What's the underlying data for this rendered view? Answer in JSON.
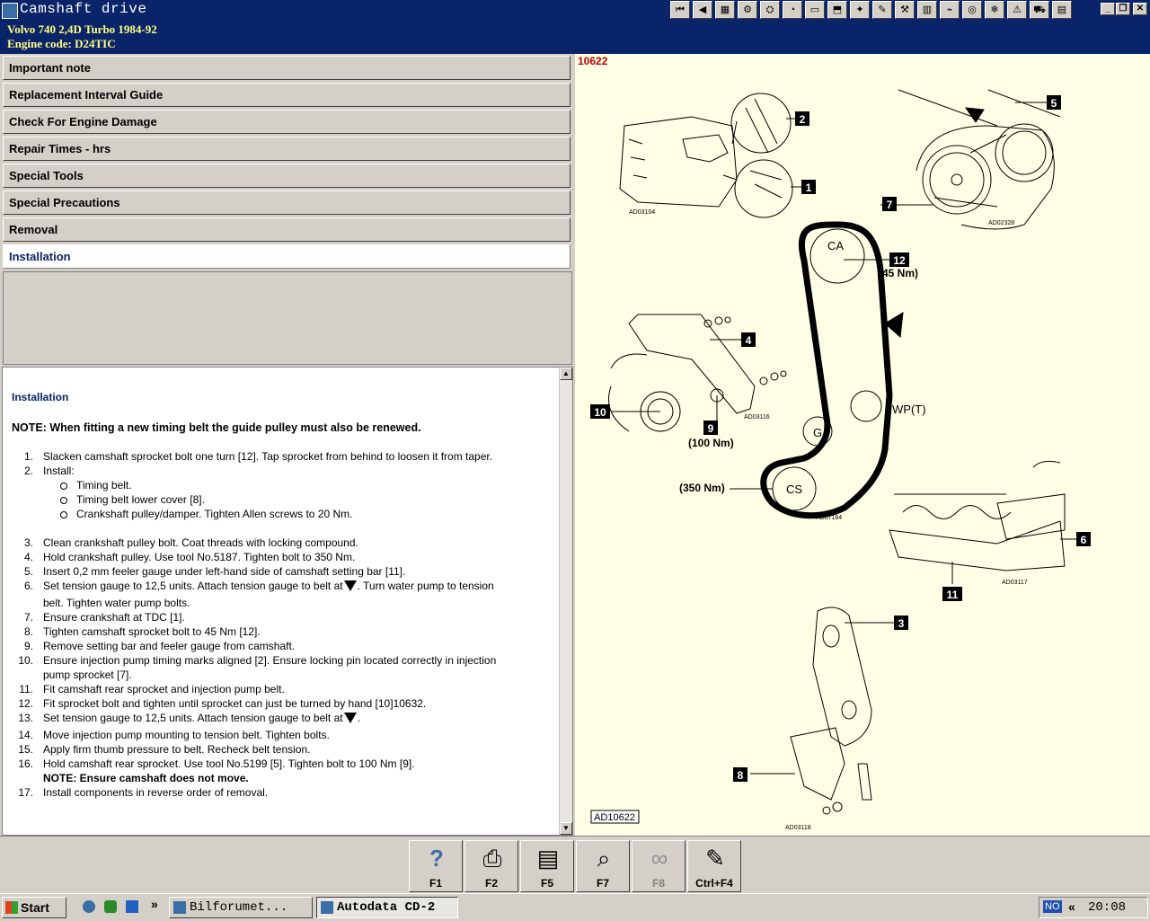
{
  "window": {
    "title": "Camshaft drive",
    "toolbar_icons": [
      "first-page-icon",
      "prev-page-icon",
      "image-icon",
      "tools-icon",
      "engine-icon",
      "gauge-icon",
      "battery-icon",
      "car-lift-icon",
      "spark-plug-icon",
      "wrench-icon",
      "repair-icon",
      "manual-icon",
      "wiring-icon",
      "brake-icon",
      "ac-icon",
      "warning-icon",
      "service-icon",
      "notes-icon"
    ],
    "controls": {
      "minimize": "_",
      "restore": "❐",
      "close": "✕"
    }
  },
  "vehicle": {
    "model": "Volvo   740 2,4D Turbo 1984-92",
    "engine_code": "Engine code: D24TIC"
  },
  "menu": {
    "items": [
      {
        "label": "Important note"
      },
      {
        "label": "Replacement Interval Guide"
      },
      {
        "label": "Check For Engine Damage"
      },
      {
        "label": "Repair Times - hrs"
      },
      {
        "label": "Special Tools"
      },
      {
        "label": "Special Precautions"
      },
      {
        "label": "Removal"
      },
      {
        "label": "Installation",
        "active": true
      }
    ]
  },
  "content": {
    "heading": "Installation",
    "note": "NOTE: When fitting a new timing belt the guide pulley must also be renewed.",
    "steps": [
      {
        "n": "1.",
        "lines": [
          "Slacken camshaft sprocket bolt one turn [12]. Tap sprocket from behind to loosen it from taper."
        ]
      },
      {
        "n": "2.",
        "lines": [
          "Install:"
        ],
        "sub": [
          "Timing belt.",
          "Timing belt lower cover [8].",
          "Crankshaft pulley/damper. Tighten Allen screws to 20 Nm."
        ]
      },
      {
        "n": "3.",
        "lines": [
          "Clean crankshaft pulley bolt. Coat threads with locking compound."
        ]
      },
      {
        "n": "4.",
        "lines": [
          "Hold crankshaft pulley. Use tool No.5187. Tighten bolt to 350 Nm."
        ]
      },
      {
        "n": "5.",
        "lines": [
          "Insert 0,2 mm feeler gauge under left-hand side of camshaft setting bar [11]."
        ]
      },
      {
        "n": "6.",
        "lines": [
          "Set tension gauge to 12,5 units. Attach tension gauge to belt at",
          ". Turn water pump to tension",
          "belt. Tighten water pump bolts."
        ]
      },
      {
        "n": "7.",
        "lines": [
          "Ensure crankshaft at TDC [1]."
        ]
      },
      {
        "n": "8.",
        "lines": [
          "Tighten camshaft sprocket bolt to 45 Nm [12]."
        ]
      },
      {
        "n": "9.",
        "lines": [
          "Remove setting bar and feeler gauge from camshaft."
        ]
      },
      {
        "n": "10.",
        "lines": [
          "Ensure injection pump timing marks aligned [2]. Ensure locking pin located correctly in injection",
          "pump sprocket [7]."
        ]
      },
      {
        "n": "11.",
        "lines": [
          "Fit camshaft rear sprocket and injection pump belt."
        ]
      },
      {
        "n": "12.",
        "lines": [
          "Fit sprocket bolt and tighten until sprocket can just be turned by hand [10]10632."
        ]
      },
      {
        "n": "13.",
        "lines": [
          "Set tension gauge to 12,5 units. Attach tension gauge to belt at",
          "."
        ]
      },
      {
        "n": "14.",
        "lines": [
          "Move injection pump mounting to tension belt. Tighten bolts."
        ]
      },
      {
        "n": "15.",
        "lines": [
          "Apply firm thumb pressure to belt. Recheck belt tension."
        ]
      },
      {
        "n": "16.",
        "lines": [
          "Hold camshaft rear sprocket. Use tool No.5199 [5]. Tighten bolt to 100 Nm [9].",
          "NOTE: Ensure camshaft does not move."
        ]
      },
      {
        "n": "17.",
        "lines": [
          "Install components in reverse order of removal."
        ]
      }
    ]
  },
  "diagram": {
    "ref": "10622",
    "code": "AD10622",
    "callouts": [
      "1",
      "2",
      "3",
      "4",
      "5",
      "6",
      "7",
      "8",
      "9",
      "10",
      "11",
      "12"
    ],
    "labels": {
      "ca": "CA",
      "wp": "WP(T)",
      "g": "G",
      "cs": "CS",
      "t12": "(45 Nm)",
      "t9": "(100 Nm)",
      "tcs": "(350 Nm)"
    },
    "subcodes": [
      "AD03104",
      "AD02328",
      "AD03116",
      "AD07184",
      "AD03117",
      "AD03118"
    ]
  },
  "function_keys": [
    {
      "label": "F1",
      "icon": "help-icon"
    },
    {
      "label": "F2",
      "icon": "print-icon"
    },
    {
      "label": "F5",
      "icon": "book-icon"
    },
    {
      "label": "F7",
      "icon": "zoom-icon"
    },
    {
      "label": "F8",
      "icon": "belt-icon",
      "disabled": true
    },
    {
      "label": "Ctrl+F4",
      "icon": "notes-icon"
    }
  ],
  "taskbar": {
    "start": "Start",
    "quicklaunch_more": "»",
    "tasks": [
      {
        "label": "Bilforumet..."
      },
      {
        "label": "Autodata CD-2",
        "active": true
      }
    ],
    "lang": "NO",
    "chevron": "«",
    "clock": "20:08"
  }
}
